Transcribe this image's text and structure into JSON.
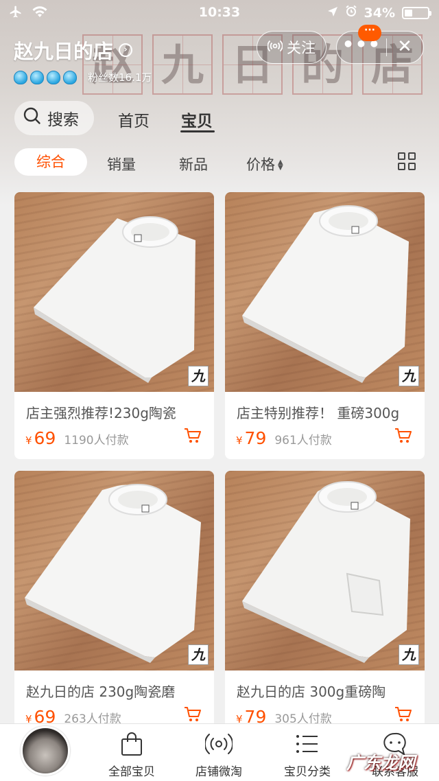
{
  "status_bar": {
    "time": "10:33",
    "battery": "34%",
    "battery_level": 0.34
  },
  "shop": {
    "name": "赵九日的店",
    "fans": "粉丝数16.1万",
    "crown_count": 4,
    "banner_chars": [
      "赵",
      "九",
      "日",
      "的",
      "店"
    ]
  },
  "header_buttons": {
    "follow": "关注",
    "more_badge": "···"
  },
  "tabs": {
    "search": "搜索",
    "home": "首页",
    "items": "宝贝"
  },
  "sort": {
    "all": "综合",
    "sales": "销量",
    "new": "新品",
    "price": "价格"
  },
  "products": [
    {
      "title": "店主强烈推荐!230g陶瓷",
      "price": "69",
      "currency": "¥",
      "sold": "1190人付款",
      "logo": "九"
    },
    {
      "title": "店主特别推荐！ 重磅300g",
      "price": "79",
      "currency": "¥",
      "sold": "961人付款",
      "logo": "九"
    },
    {
      "title": "赵九日的店 230g陶瓷磨",
      "price": "69",
      "currency": "¥",
      "sold": "263人付款",
      "logo": "九"
    },
    {
      "title": "赵九日的店 300g重磅陶",
      "price": "79",
      "currency": "¥",
      "sold": "305人付款",
      "logo": "九"
    }
  ],
  "bottom_nav": {
    "all_items": "全部宝贝",
    "weitao": "店铺微淘",
    "categories": "宝贝分类",
    "service": "联系客服"
  },
  "watermark": "广东龙网",
  "colors": {
    "accent": "#ff5000",
    "badge": "#ff5a00",
    "page_bg": "#f0f0f0"
  }
}
